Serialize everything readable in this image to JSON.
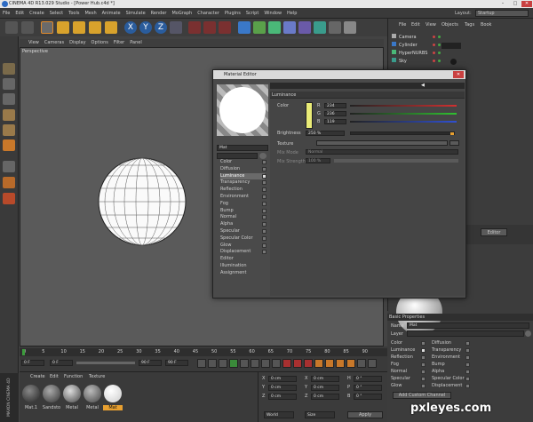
{
  "window": {
    "title": "CINEMA 4D R13.029 Studio - [Power Hub.c4d *]",
    "min": "–",
    "max": "□",
    "close": "✕"
  },
  "menu": [
    "File",
    "Edit",
    "Create",
    "Select",
    "Tools",
    "Mesh",
    "Animate",
    "Simulate",
    "Render",
    "MoGraph",
    "Character",
    "Plugins",
    "Script",
    "Window",
    "Help"
  ],
  "layout": {
    "label": "Layout:",
    "value": "Startup"
  },
  "viewport": {
    "menu": [
      "View",
      "Cameras",
      "Display",
      "Options",
      "Filter",
      "Panel"
    ],
    "label": "Perspective"
  },
  "axes": [
    "X",
    "Y",
    "Z"
  ],
  "objects": {
    "menu": [
      "File",
      "Edit",
      "View",
      "Objects",
      "Tags",
      "Book"
    ],
    "items": [
      "Camera",
      "Cylinder",
      "HyperNURBS",
      "Sky"
    ]
  },
  "material_editor": {
    "title": "Material Editor",
    "material_name": "Mat",
    "section": "Luminance",
    "channels": [
      "Color",
      "Diffusion",
      "Luminance",
      "Transparency",
      "Reflection",
      "Environment",
      "Fog",
      "Bump",
      "Normal",
      "Alpha",
      "Specular",
      "Specular Color",
      "Glow",
      "Displacement",
      "Editor",
      "Illumination",
      "Assignment"
    ],
    "active_channel": "Luminance",
    "color_label": "Color",
    "r": {
      "label": "R",
      "value": "234"
    },
    "g": {
      "label": "G",
      "value": "236"
    },
    "b": {
      "label": "B",
      "value": "119"
    },
    "brightness": {
      "label": "Brightness",
      "value": "250 %"
    },
    "texture_label": "Texture",
    "mix_mode": {
      "label": "Mix Mode",
      "value": "Normal"
    },
    "mix_strength": {
      "label": "Mix Strength",
      "value": "100 %"
    },
    "swatch_color": "#eaec77"
  },
  "editor_tab": "Editor",
  "timeline": {
    "ticks": [
      "0",
      "5",
      "10",
      "15",
      "20",
      "25",
      "30",
      "35",
      "40",
      "45",
      "50",
      "55",
      "60",
      "65",
      "70",
      "75",
      "80",
      "85",
      "90"
    ],
    "start": "0 F",
    "current": "0 F",
    "end": "90 F",
    "end2": "90 F"
  },
  "material_manager": {
    "menu": [
      "Create",
      "Edit",
      "Function",
      "Texture"
    ],
    "materials": [
      "Mat.1",
      "Sandsto",
      "Metal",
      "Metal",
      "Mat"
    ]
  },
  "coords": {
    "rows": [
      [
        "X",
        "0 cm",
        "X",
        "0 cm",
        "H",
        "0 °"
      ],
      [
        "Y",
        "0 cm",
        "Y",
        "0 cm",
        "P",
        "0 °"
      ],
      [
        "Z",
        "0 cm",
        "Z",
        "0 cm",
        "B",
        "0 °"
      ]
    ],
    "mode1": "World",
    "mode2": "Size",
    "apply": "Apply"
  },
  "attributes": {
    "title": "Basic Properties",
    "name_label": "Name",
    "name_value": "Mat",
    "layer_label": "Layer",
    "left": [
      "Color",
      "Luminance",
      "Reflection",
      "Fog",
      "Normal",
      "Specular",
      "Glow"
    ],
    "right": [
      "Diffusion",
      "Transparency",
      "Environment",
      "Bump",
      "Alpha",
      "Specular Color",
      "Displacement"
    ],
    "button": "Add Custom Channel"
  },
  "brand": "MAXON CINEMA 4D",
  "watermark": "pxleyes.com"
}
